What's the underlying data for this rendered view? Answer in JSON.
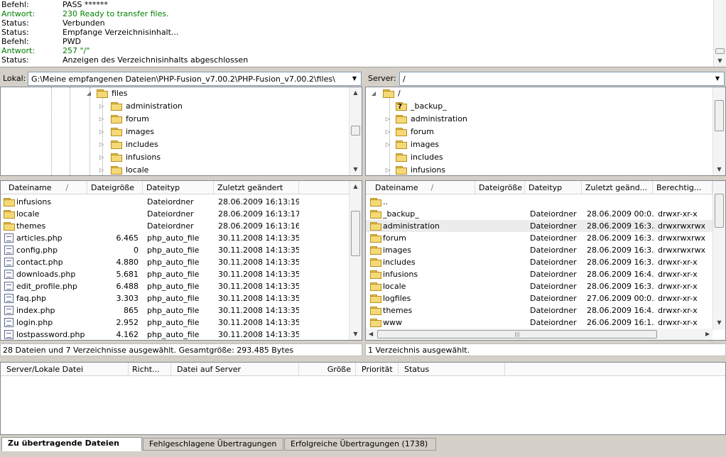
{
  "log": [
    {
      "key": "Befehl:",
      "value": "PASS ******",
      "green": false
    },
    {
      "key": "Antwort:",
      "value": "230 Ready to transfer files.",
      "green": true
    },
    {
      "key": "Status:",
      "value": "Verbunden",
      "green": false
    },
    {
      "key": "Status:",
      "value": "Empfange Verzeichnisinhalt...",
      "green": false
    },
    {
      "key": "Befehl:",
      "value": "PWD",
      "green": false
    },
    {
      "key": "Antwort:",
      "value": "257 \"/\"",
      "green": true
    },
    {
      "key": "Status:",
      "value": "Anzeigen des Verzeichnisinhalts abgeschlossen",
      "green": false
    }
  ],
  "local": {
    "label": "Lokal:",
    "path": "G:\\Meine empfangenen Dateien\\PHP-Fusion_v7.00.2\\PHP-Fusion_v7.00.2\\files\\",
    "tree": [
      {
        "name": "files",
        "expanded": true
      },
      {
        "name": "administration"
      },
      {
        "name": "forum"
      },
      {
        "name": "images"
      },
      {
        "name": "includes"
      },
      {
        "name": "infusions"
      },
      {
        "name": "locale"
      }
    ],
    "columns": [
      "Dateiname",
      "Dateigröße",
      "Dateityp",
      "Zuletzt geändert"
    ],
    "sort_indicator": "/",
    "rows": [
      {
        "name": "infusions",
        "size": "",
        "type": "Dateiordner",
        "modified": "28.06.2009 16:13:19",
        "folder": true
      },
      {
        "name": "locale",
        "size": "",
        "type": "Dateiordner",
        "modified": "28.06.2009 16:13:17",
        "folder": true
      },
      {
        "name": "themes",
        "size": "",
        "type": "Dateiordner",
        "modified": "28.06.2009 16:13:16",
        "folder": true
      },
      {
        "name": "articles.php",
        "size": "6.465",
        "type": "php_auto_file",
        "modified": "30.11.2008 14:13:35",
        "folder": false
      },
      {
        "name": "config.php",
        "size": "0",
        "type": "php_auto_file",
        "modified": "30.11.2008 14:13:35",
        "folder": false
      },
      {
        "name": "contact.php",
        "size": "4.880",
        "type": "php_auto_file",
        "modified": "30.11.2008 14:13:35",
        "folder": false
      },
      {
        "name": "downloads.php",
        "size": "5.681",
        "type": "php_auto_file",
        "modified": "30.11.2008 14:13:35",
        "folder": false
      },
      {
        "name": "edit_profile.php",
        "size": "6.488",
        "type": "php_auto_file",
        "modified": "30.11.2008 14:13:35",
        "folder": false
      },
      {
        "name": "faq.php",
        "size": "3.303",
        "type": "php_auto_file",
        "modified": "30.11.2008 14:13:35",
        "folder": false
      },
      {
        "name": "index.php",
        "size": "865",
        "type": "php_auto_file",
        "modified": "30.11.2008 14:13:35",
        "folder": false
      },
      {
        "name": "login.php",
        "size": "2.952",
        "type": "php_auto_file",
        "modified": "30.11.2008 14:13:35",
        "folder": false
      },
      {
        "name": "lostpassword.php",
        "size": "4.162",
        "type": "php_auto_file",
        "modified": "30.11.2008 14:13:35",
        "folder": false
      }
    ],
    "status": "28 Dateien und 7 Verzeichnisse ausgewählt. Gesamtgröße: 293.485 Bytes"
  },
  "remote": {
    "label": "Server:",
    "path": "/",
    "tree": [
      {
        "name": "/",
        "expanded": true
      },
      {
        "name": "_backup_",
        "unknown": true
      },
      {
        "name": "administration"
      },
      {
        "name": "forum"
      },
      {
        "name": "images"
      },
      {
        "name": "includes"
      },
      {
        "name": "infusions"
      }
    ],
    "columns": [
      "Dateiname",
      "Dateigröße",
      "Dateityp",
      "Zuletzt geänd...",
      "Berechtig..."
    ],
    "sort_indicator": "/",
    "rows": [
      {
        "name": "..",
        "type": "",
        "modified": "",
        "perms": ""
      },
      {
        "name": "_backup_",
        "type": "Dateiordner",
        "modified": "28.06.2009 00:0...",
        "perms": "drwxr-xr-x"
      },
      {
        "name": "administration",
        "type": "Dateiordner",
        "modified": "28.06.2009 16:3...",
        "perms": "drwxrwxrwx",
        "selected": true
      },
      {
        "name": "forum",
        "type": "Dateiordner",
        "modified": "28.06.2009 16:3...",
        "perms": "drwxrwxrwx"
      },
      {
        "name": "images",
        "type": "Dateiordner",
        "modified": "28.06.2009 16:3...",
        "perms": "drwxrwxrwx"
      },
      {
        "name": "includes",
        "type": "Dateiordner",
        "modified": "28.06.2009 16:3...",
        "perms": "drwxr-xr-x"
      },
      {
        "name": "infusions",
        "type": "Dateiordner",
        "modified": "28.06.2009 16:4...",
        "perms": "drwxr-xr-x"
      },
      {
        "name": "locale",
        "type": "Dateiordner",
        "modified": "28.06.2009 16:3...",
        "perms": "drwxr-xr-x"
      },
      {
        "name": "logfiles",
        "type": "Dateiordner",
        "modified": "27.06.2009 00:0...",
        "perms": "drwxr-xr-x"
      },
      {
        "name": "themes",
        "type": "Dateiordner",
        "modified": "28.06.2009 16:4...",
        "perms": "drwxr-xr-x"
      },
      {
        "name": "www",
        "type": "Dateiordner",
        "modified": "26.06.2009 16:1...",
        "perms": "drwxr-xr-x"
      }
    ],
    "status": "1 Verzeichnis ausgewählt."
  },
  "queue": {
    "columns": [
      "Server/Lokale Datei",
      "Richt...",
      "Datei auf Server",
      "Größe",
      "Priorität",
      "Status"
    ]
  },
  "tabs": [
    "Zu übertragende Dateien",
    "Fehlgeschlagene Übertragungen",
    "Erfolgreiche Übertragungen (1738)"
  ]
}
